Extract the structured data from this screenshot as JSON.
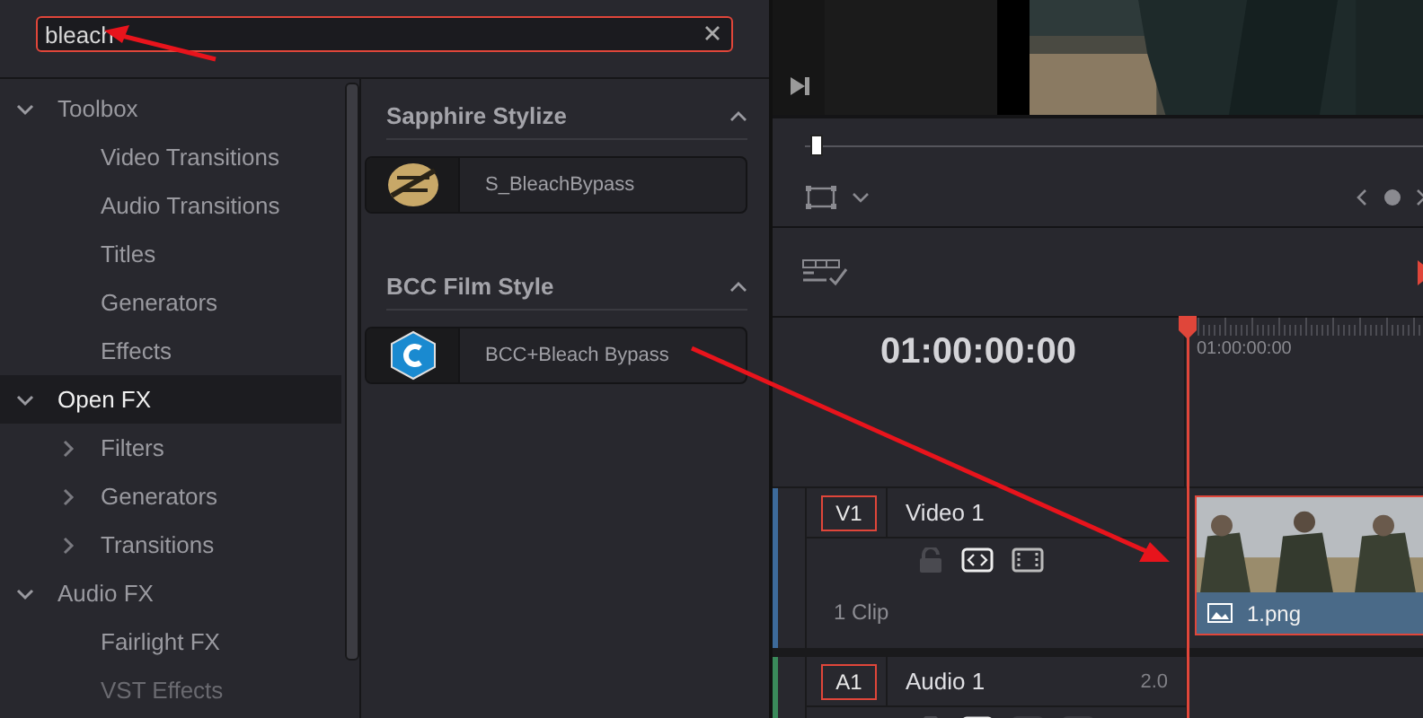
{
  "search": {
    "value": "bleach"
  },
  "tree": [
    {
      "label": "Toolbox",
      "expanded": true,
      "selected": false,
      "children": [
        {
          "label": "Video Transitions",
          "selected": false
        },
        {
          "label": "Audio Transitions",
          "selected": false
        },
        {
          "label": "Titles",
          "selected": false
        },
        {
          "label": "Generators",
          "selected": false
        },
        {
          "label": "Effects",
          "selected": false
        }
      ]
    },
    {
      "label": "Open FX",
      "expanded": true,
      "selected": true,
      "children": [
        {
          "label": "Filters",
          "expanded": false,
          "selected": false
        },
        {
          "label": "Generators",
          "expanded": false,
          "selected": false
        },
        {
          "label": "Transitions",
          "expanded": false,
          "selected": false
        }
      ]
    },
    {
      "label": "Audio FX",
      "expanded": true,
      "selected": false,
      "children": [
        {
          "label": "Fairlight FX",
          "selected": false
        },
        {
          "label": "VST Effects",
          "selected": false
        }
      ]
    }
  ],
  "results": [
    {
      "title": "Sapphire Stylize",
      "expanded": true,
      "items": [
        {
          "name": "S_BleachBypass",
          "kind": "sapphire"
        }
      ]
    },
    {
      "title": "BCC Film Style",
      "expanded": true,
      "items": [
        {
          "name": "BCC+Bleach Bypass",
          "kind": "bcc"
        }
      ]
    }
  ],
  "scrubber": {
    "level": 0.01
  },
  "timeline": {
    "timecode": "01:00:00:00",
    "ruler_label": "01:00:00:00",
    "tracks": [
      {
        "kind": "video",
        "badge": "V1",
        "name": "Video 1",
        "clip_count": "1 Clip",
        "clip": {
          "name": "1.png"
        }
      },
      {
        "kind": "audio",
        "badge": "A1",
        "name": "Audio 1",
        "channels": "2.0"
      }
    ]
  }
}
